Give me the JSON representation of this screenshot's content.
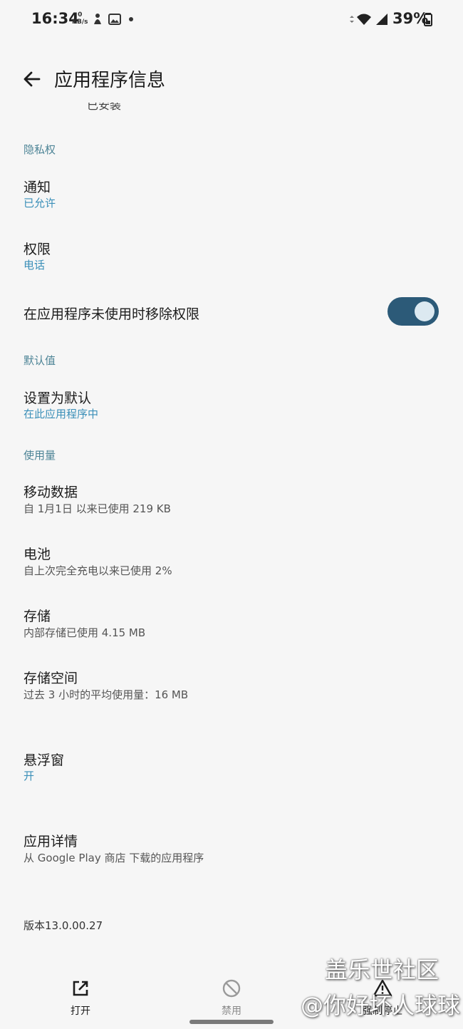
{
  "status_bar": {
    "time": "16:34",
    "speed_value": "0",
    "speed_unit": "KB/s",
    "battery": "39%"
  },
  "header": {
    "title": "应用程序信息",
    "cutoff_text": "已安装"
  },
  "privacy": {
    "header": "隐私权",
    "notifications": {
      "title": "通知",
      "subtitle": "已允许"
    },
    "permissions": {
      "title": "权限",
      "subtitle": "电话"
    },
    "remove_permissions": {
      "title": "在应用程序未使用时移除权限",
      "enabled": true
    }
  },
  "defaults": {
    "header": "默认值",
    "set_default": {
      "title": "设置为默认",
      "subtitle": "在此应用程序中"
    }
  },
  "usage": {
    "header": "使用量",
    "mobile_data": {
      "title": "移动数据",
      "subtitle": "自 1月1日 以来已使用 219 KB"
    },
    "battery": {
      "title": "电池",
      "subtitle": "自上次完全充电以来已使用 2%"
    },
    "storage": {
      "title": "存储",
      "subtitle": "内部存储已使用 4.15 MB"
    },
    "memory": {
      "title": "存储空间",
      "subtitle": "过去 3 小时的平均使用量：16 MB"
    }
  },
  "floating_window": {
    "title": "悬浮窗",
    "subtitle": "开"
  },
  "app_details": {
    "title": "应用详情",
    "subtitle": "从 Google Play 商店 下载的应用程序"
  },
  "version": "版本13.0.00.27",
  "bottom_actions": {
    "open": "打开",
    "disable": "禁用",
    "force_stop": "强制停止"
  },
  "watermark": {
    "line1": "盖乐世社区",
    "line2": "@你好坏人球球"
  },
  "colors": {
    "accent": "#3a8fb8",
    "section_header": "#4d8496",
    "toggle_track": "#2c5a78"
  }
}
